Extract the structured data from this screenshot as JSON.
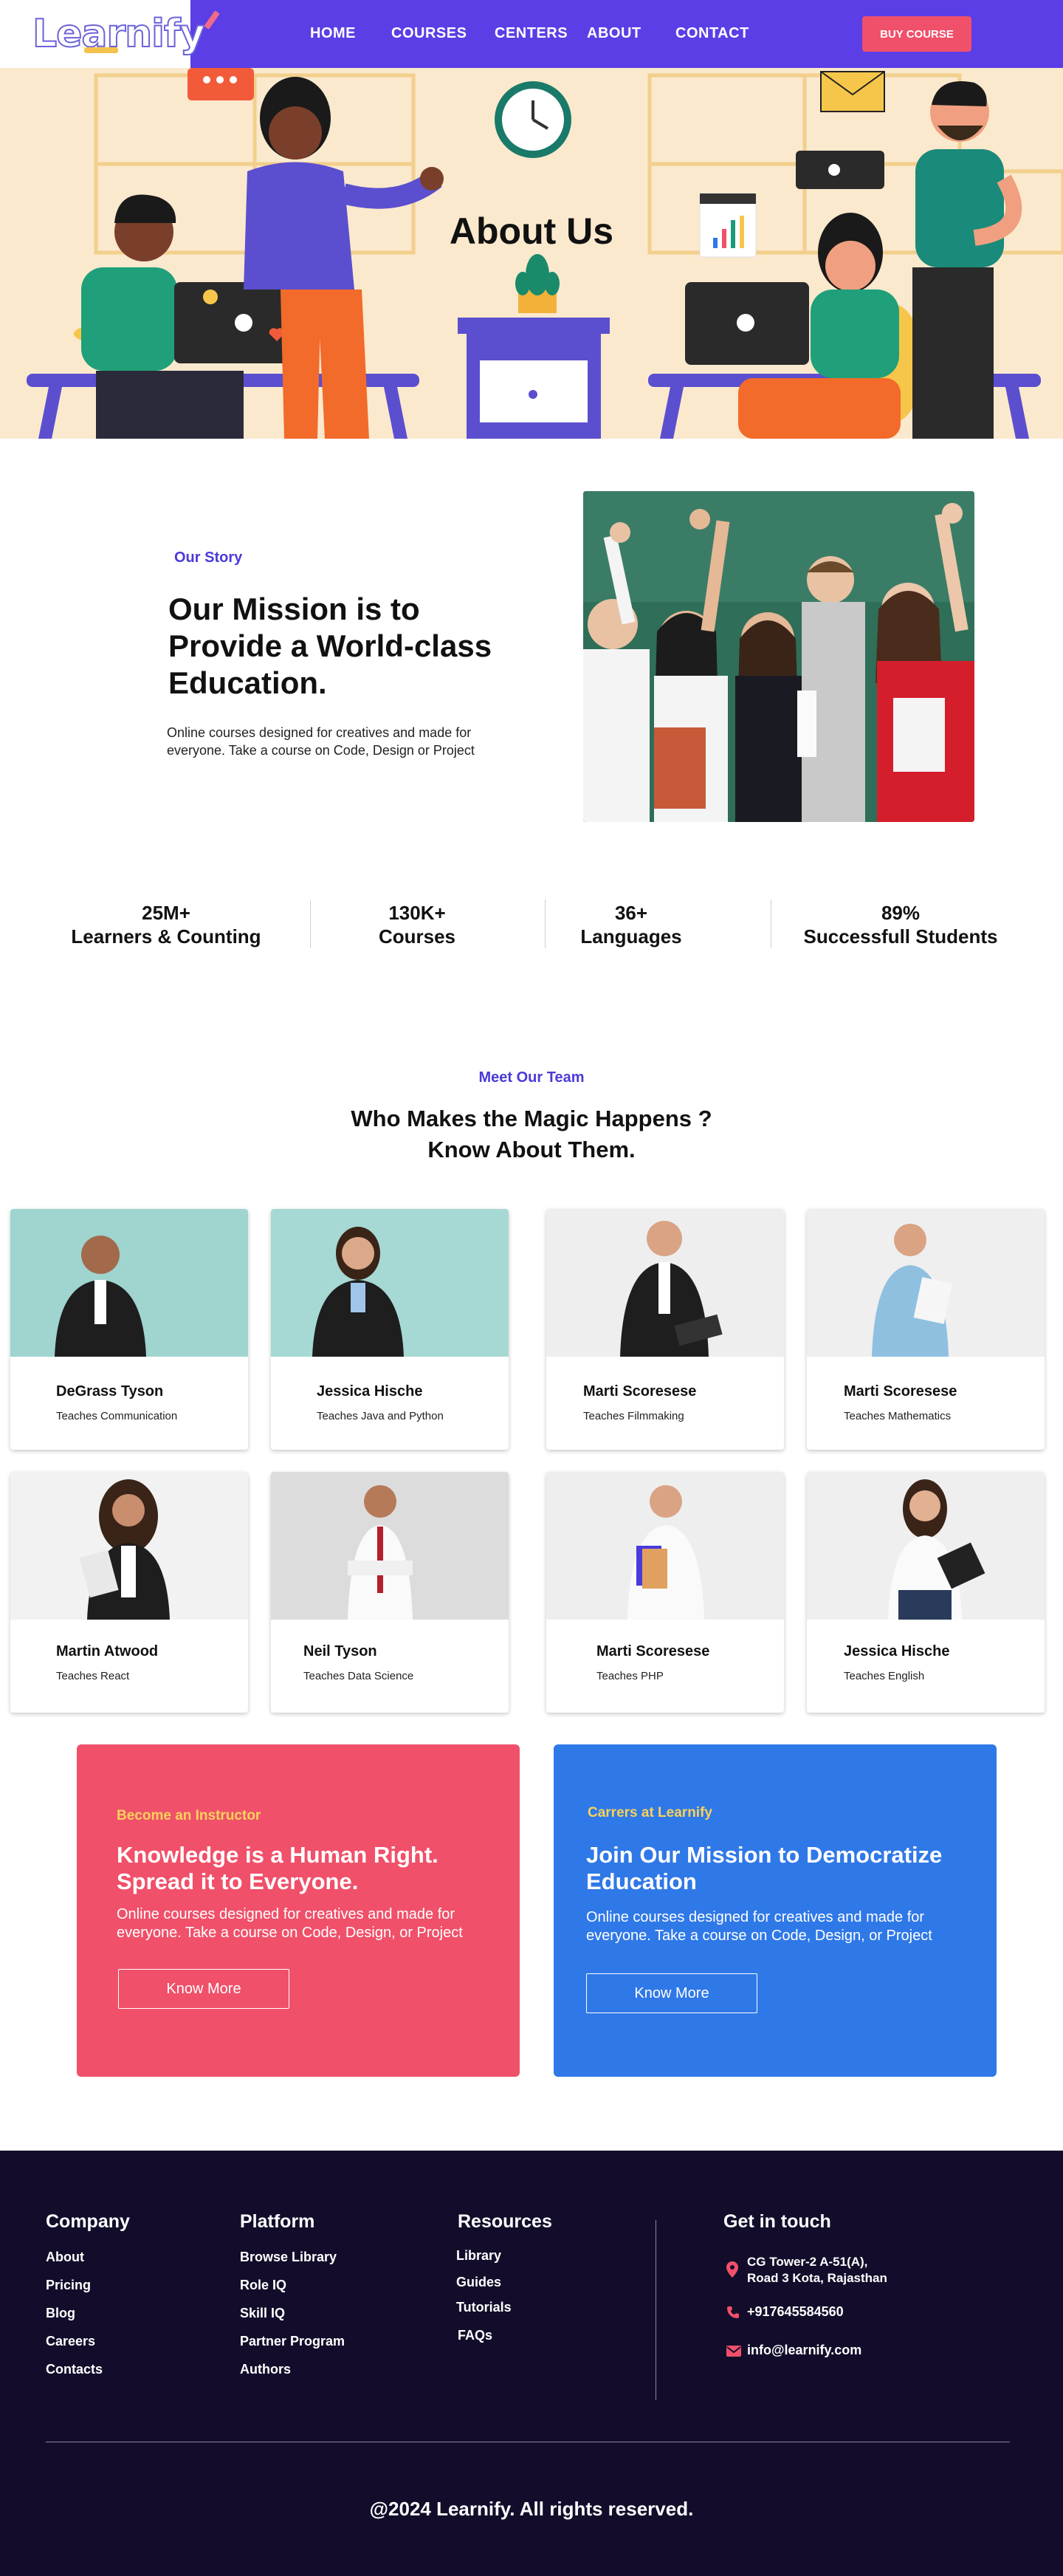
{
  "brand": {
    "logo_text": "Learnify",
    "accent": "#5b3ee6",
    "cta_red": "#f0506a",
    "cta_blue": "#2f78e8",
    "footer_bg": "#130d2b"
  },
  "nav": {
    "links": [
      "HOME",
      "COURSES",
      "CENTERS",
      "ABOUT",
      "CONTACT"
    ],
    "buy_label": "BUY COURSE"
  },
  "hero": {
    "title": "About Us"
  },
  "story": {
    "eyebrow": "Our Story",
    "title": "Our Mission is to Provide a World-class Education.",
    "text": "Online courses designed for creatives and made for everyone. Take a course on Code, Design or Project"
  },
  "stats": [
    {
      "value": "25M+",
      "label": "Learners & Counting"
    },
    {
      "value": "130K+",
      "label": "Courses"
    },
    {
      "value": "36+",
      "label": "Languages"
    },
    {
      "value": "89%",
      "label": "Successfull Students"
    }
  ],
  "team": {
    "eyebrow": "Meet Our Team",
    "title_line1": "Who Makes the Magic Happens ?",
    "title_line2": "Know About Them.",
    "members": [
      {
        "name": "DeGrass Tyson",
        "role": "Teaches Communication"
      },
      {
        "name": "Jessica Hische",
        "role": "Teaches Java and Python"
      },
      {
        "name": "Marti Scoresese",
        "role": "Teaches Filmmaking"
      },
      {
        "name": "Marti Scoresese",
        "role": "Teaches Mathematics"
      },
      {
        "name": "Martin Atwood",
        "role": "Teaches React"
      },
      {
        "name": "Neil Tyson",
        "role": "Teaches Data Science"
      },
      {
        "name": "Marti Scoresese",
        "role": "Teaches PHP"
      },
      {
        "name": "Jessica Hische",
        "role": "Teaches English"
      }
    ]
  },
  "cta": [
    {
      "eyebrow": "Become an Instructor",
      "title": "Knowledge is a Human Right. Spread it to Everyone.",
      "text": "Online courses designed for creatives and made for everyone. Take a course on Code, Design, or Project",
      "button": "Know More"
    },
    {
      "eyebrow": "Carrers at Learnify",
      "title": "Join Our Mission to Democratize Education",
      "text": "Online courses designed for creatives and made for everyone. Take a course on Code, Design, or Project",
      "button": "Know More"
    }
  ],
  "footer": {
    "company": {
      "heading": "Company",
      "links": [
        "About",
        "Pricing",
        "Blog",
        "Careers",
        "Contacts"
      ]
    },
    "platform": {
      "heading": "Platform",
      "links": [
        "Browse Library",
        "Role IQ",
        "Skill IQ",
        "Partner Program",
        "Authors"
      ]
    },
    "resources": {
      "heading": "Resources",
      "links": [
        "Library",
        "Guides",
        "Tutorials",
        "FAQs"
      ]
    },
    "contact": {
      "heading": "Get in touch",
      "address_line1": "CG Tower-2 A-51(A),",
      "address_line2": "Road 3 Kota, Rajasthan",
      "phone": "+917645584560",
      "email": "info@learnify.com"
    },
    "copyright": "@2024 Learnify. All rights reserved."
  }
}
